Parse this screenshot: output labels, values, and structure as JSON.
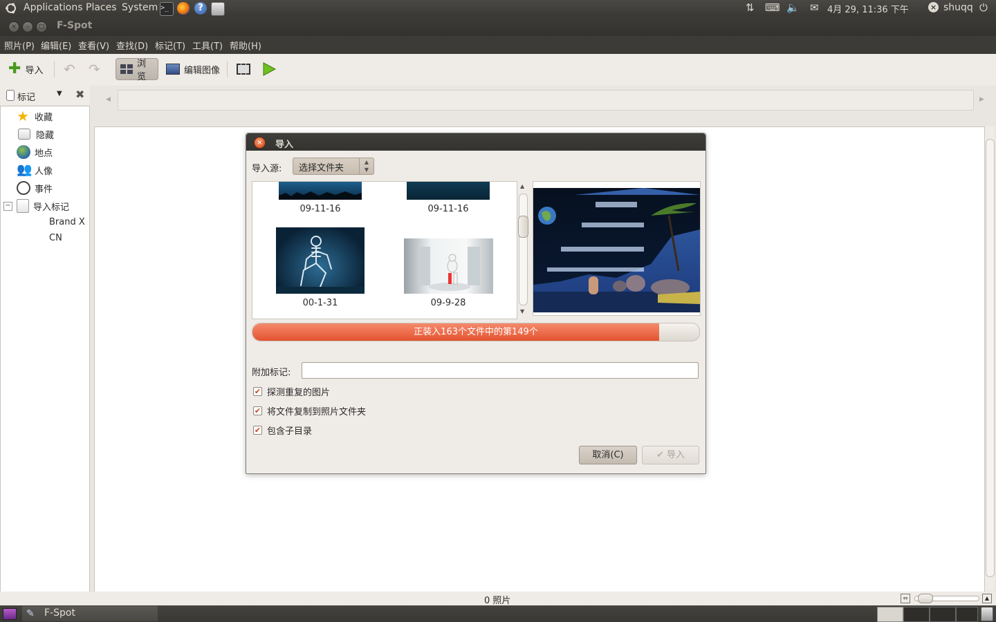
{
  "top_panel": {
    "menus": [
      "Applications",
      "Places",
      "System"
    ],
    "clock": "4月 29, 11:36 下午",
    "user": "shuqq"
  },
  "window": {
    "title": "F-Spot",
    "menu": [
      "照片(P)",
      "编辑(E)",
      "查看(V)",
      "查找(D)",
      "标记(T)",
      "工具(T)",
      "帮助(H)"
    ]
  },
  "toolbar": {
    "import_label": "导入",
    "browse_label": "浏览",
    "edit_image_label": "编辑图像"
  },
  "tag_pane": {
    "header": "标记",
    "items": [
      "收藏",
      "隐藏",
      "地点",
      "人像",
      "事件",
      "导入标记"
    ],
    "subitems": [
      "Brand X",
      "CN"
    ]
  },
  "status": {
    "photo_count": "0 照片"
  },
  "taskbar": {
    "task": "F-Spot"
  },
  "dialog": {
    "title": "导入",
    "source_label": "导入源:",
    "source_value": "选择文件夹",
    "thumbnails": [
      "09-11-16",
      "09-11-16",
      "00-1-31",
      "09-9-28"
    ],
    "progress_text": "正装入163个文件中的第149个",
    "progress_fraction": 0.91,
    "attach_tag_label": "附加标记:",
    "attach_tag_value": "",
    "options": [
      "探测重复的图片",
      "将文件复制到照片文件夹",
      "包含子目录"
    ],
    "cancel_label": "取消(C)",
    "import_label": "导入"
  },
  "colors": {
    "accent": "#e4532f",
    "panel": "#3c3b37",
    "window_bg": "#efebe7"
  }
}
